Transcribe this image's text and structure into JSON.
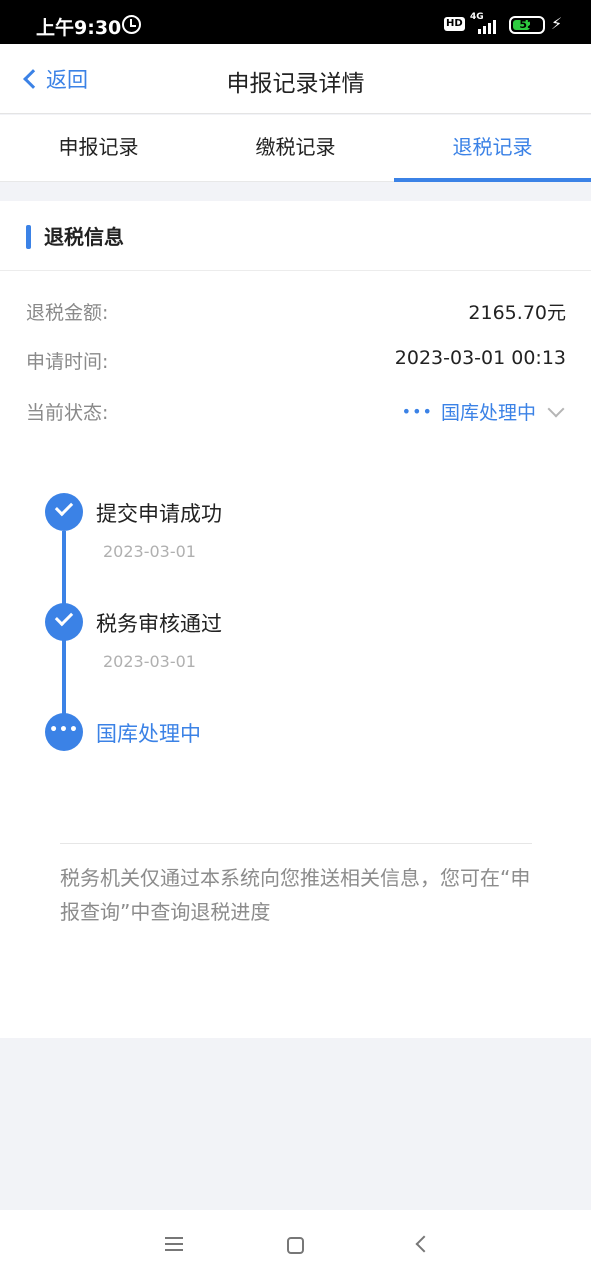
{
  "status_bar": {
    "time": "上午9:30",
    "hd": "HD",
    "network": "4G",
    "battery": "52",
    "battery_level": 0.52
  },
  "header": {
    "back_label": "返回",
    "title": "申报记录详情"
  },
  "tabs": [
    {
      "label": "申报记录",
      "active": false
    },
    {
      "label": "缴税记录",
      "active": false
    },
    {
      "label": "退税记录",
      "active": true
    }
  ],
  "section": {
    "title": "退税信息",
    "fields": [
      {
        "key": "退税金额:",
        "value": "2165.70元"
      },
      {
        "key": "申请时间:",
        "value": "2023-03-01 00:13"
      },
      {
        "key": "当前状态:",
        "value": "国库处理中"
      }
    ],
    "status_dots": "•••"
  },
  "timeline": [
    {
      "label": "提交申请成功",
      "date": "2023-03-01",
      "done": true
    },
    {
      "label": "税务审核通过",
      "date": "2023-03-01",
      "done": true
    },
    {
      "label": "国库处理中",
      "date": "",
      "done": false,
      "dots": "•••"
    }
  ],
  "note": "税务机关仅通过本系统向您推送相关信息，您可在“申报查询”中查询退税进度",
  "colors": {
    "accent": "#3b82e6",
    "battery": "#2ecc40",
    "muted_text": "#8a8a8a"
  }
}
